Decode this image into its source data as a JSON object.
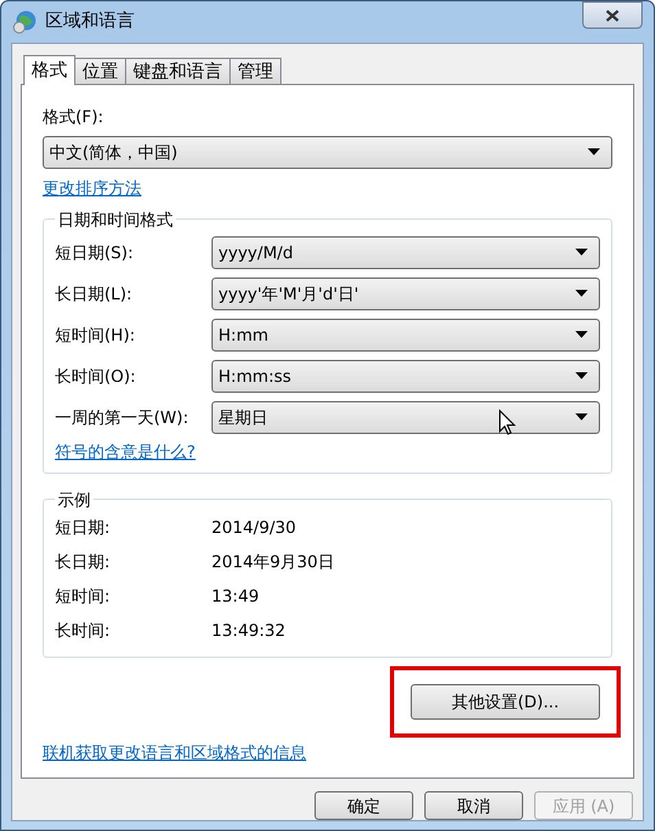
{
  "window": {
    "title": "区域和语言"
  },
  "tabs": [
    {
      "label": "格式",
      "selected": true
    },
    {
      "label": "位置",
      "selected": false
    },
    {
      "label": "键盘和语言",
      "selected": false
    },
    {
      "label": "管理",
      "selected": false
    }
  ],
  "format": {
    "label": "格式(F):",
    "value": "中文(简体，中国)"
  },
  "sort_link": "更改排序方法",
  "date_time_group": {
    "title": "日期和时间格式",
    "rows": [
      {
        "label": "短日期(S):",
        "value": "yyyy/M/d"
      },
      {
        "label": "长日期(L):",
        "value": "yyyy'年'M'月'd'日'"
      },
      {
        "label": "短时间(H):",
        "value": "H:mm"
      },
      {
        "label": "长时间(O):",
        "value": "H:mm:ss"
      },
      {
        "label": "一周的第一天(W):",
        "value": "星期日"
      }
    ],
    "link": "符号的含意是什么?"
  },
  "example_group": {
    "title": "示例",
    "rows": [
      {
        "label": "短日期:",
        "value": "2014/9/30"
      },
      {
        "label": "长日期:",
        "value": "2014年9月30日"
      },
      {
        "label": "短时间:",
        "value": "13:49"
      },
      {
        "label": "长时间:",
        "value": "13:49:32"
      }
    ]
  },
  "other_settings_button": "其他设置(D)...",
  "online_link": "联机获取更改语言和区域格式的信息",
  "buttons": [
    {
      "label": "确定",
      "disabled": false
    },
    {
      "label": "取消",
      "disabled": false
    },
    {
      "label": "应用 (A)",
      "disabled": true
    }
  ]
}
